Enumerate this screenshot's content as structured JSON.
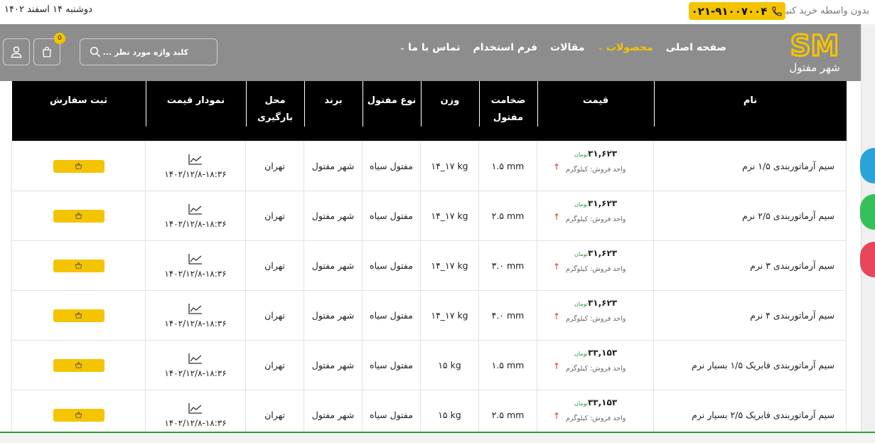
{
  "topbar": {
    "date": "دوشنبه ۱۴ اسفند ۱۴۰۲",
    "buy_text": "بدون واسطه خرید کنید",
    "phone": "۰۲۱-۹۱۰۰۷۰۰۴"
  },
  "brand": {
    "logo_letters": "SM",
    "logo_text": "شهر مفتول",
    "color": "#f4c400"
  },
  "nav": {
    "items": [
      {
        "label": "صفحه اصلی"
      },
      {
        "label": "محصولات"
      },
      {
        "label": "مقالات"
      },
      {
        "label": "فرم استخدام"
      },
      {
        "label": "تماس با ما"
      }
    ]
  },
  "search": {
    "placeholder": "کلید واژه مورد نظر ..."
  },
  "cart": {
    "count": "0"
  },
  "table": {
    "headers": {
      "name": "نام",
      "price": "قیمت",
      "thickness": "ضخامت مفتول",
      "weight": "وزن",
      "type": "نوع مفتول",
      "brand": "برند",
      "loading": "محل بارگیری",
      "chart": "نمودار قیمت",
      "order": "ثبت سفارش"
    },
    "currency": "تومان",
    "unit": "واحد فروش: کیلوگرم",
    "rows": [
      {
        "name": "سیم آرماتوربندی ۱/۵ نرم",
        "price": "۳۱,۶۲۳",
        "thickness": "۱.۵ mm",
        "weight": "۱۴_۱۷ kg",
        "type": "مفتول سیاه",
        "brand": "شهر مفتول",
        "loading": "تهران",
        "date": "۱۴۰۲/۱۲/۸-۱۸:۳۶"
      },
      {
        "name": "سیم آرماتوربندی ۲/۵ نرم",
        "price": "۳۱,۶۲۳",
        "thickness": "۲.۵ mm",
        "weight": "۱۴_۱۷ kg",
        "type": "مفتول سیاه",
        "brand": "شهر مفتول",
        "loading": "تهران",
        "date": "۱۴۰۲/۱۲/۸-۱۸:۳۶"
      },
      {
        "name": "سیم آرماتوربندی ۳ نرم",
        "price": "۳۱,۶۲۳",
        "thickness": "۳.۰ mm",
        "weight": "۱۴_۱۷ kg",
        "type": "مفتول سیاه",
        "brand": "شهر مفتول",
        "loading": "تهران",
        "date": "۱۴۰۲/۱۲/۸-۱۸:۳۶"
      },
      {
        "name": "سیم آرماتوربندی ۴ نرم",
        "price": "۳۱,۶۲۳",
        "thickness": "۴.۰ mm",
        "weight": "۱۴_۱۷ kg",
        "type": "مفتول سیاه",
        "brand": "شهر مفتول",
        "loading": "تهران",
        "date": "۱۴۰۲/۱۲/۸-۱۸:۳۶"
      },
      {
        "name": "سیم آرماتوربندی فابریک ۱/۵ بسیار نرم",
        "price": "۳۳,۱۵۳",
        "thickness": "۱.۵ mm",
        "weight": "۱۵ kg",
        "type": "مفتول سیاه",
        "brand": "شهر مفتول",
        "loading": "تهران",
        "date": "۱۴۰۲/۱۲/۸-۱۸:۳۶"
      },
      {
        "name": "سیم آرماتوربندی فابریک ۲/۵ بسیار نرم",
        "price": "۳۳,۱۵۳",
        "thickness": "۲.۵ mm",
        "weight": "۱۵ kg",
        "type": "مفتول سیاه",
        "brand": "شهر مفتول",
        "loading": "تهران",
        "date": "۱۴۰۲/۱۲/۸-۱۸:۳۶"
      }
    ]
  },
  "floating": [
    {
      "icon": "telegram-icon",
      "color": "#2aa3d8"
    },
    {
      "icon": "whatsapp-icon",
      "color": "#35c15a"
    },
    {
      "icon": "heart-icon",
      "color": "#e9455a"
    }
  ]
}
